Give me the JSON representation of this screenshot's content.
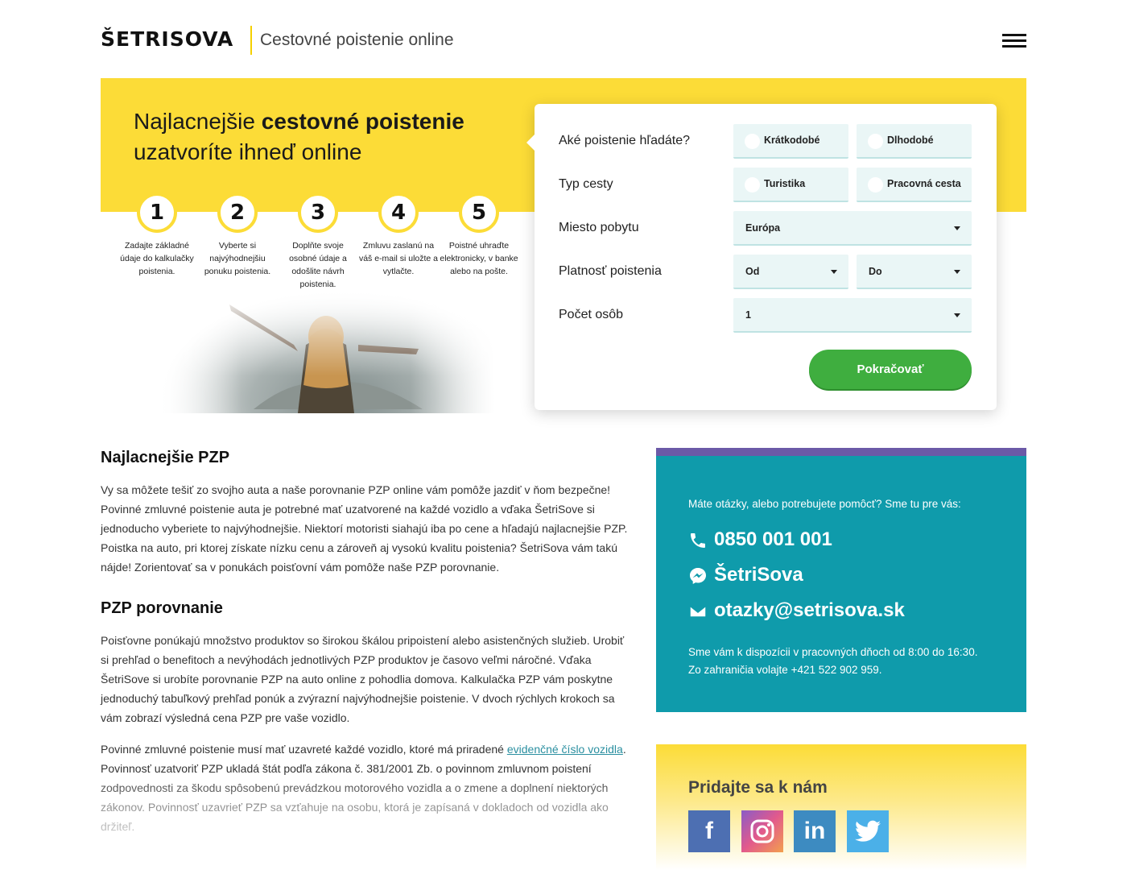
{
  "header": {
    "logo": "ŠETRISOVA",
    "tagline": "Cestovné poistenie online",
    "menu_icon": "hamburger-menu-icon"
  },
  "hero": {
    "title_prefix": "Najlacnejšie ",
    "title_bold": "cestovné poistenie",
    "title_suffix": "uzatvoríte ihneď online",
    "steps": [
      {
        "number": "1",
        "text": "Zadajte základné údaje do kalkulačky poistenia."
      },
      {
        "number": "2",
        "text": "Vyberte si najvýhodnejšiu ponuku poistenia."
      },
      {
        "number": "3",
        "text": "Doplňte svoje osobné údaje a odošlite návrh poistenia."
      },
      {
        "number": "4",
        "text": "Zmluvu zaslanú na váš e-mail si uložte a vytlačte."
      },
      {
        "number": "5",
        "text": "Poistné uhraďte elektronicky, v banke alebo na pošte."
      }
    ]
  },
  "form": {
    "type_label": "Aké poistenie hľadáte?",
    "type_options": [
      "Krátkodobé",
      "Dlhodobé"
    ],
    "trip_label": "Typ cesty",
    "trip_options": [
      "Turistika",
      "Pracovná cesta"
    ],
    "place_label": "Miesto pobytu",
    "place_value": "Európa",
    "validity_label": "Platnosť poistenia",
    "validity_from": "Od",
    "validity_to": "Do",
    "persons_label": "Počet osôb",
    "persons_value": "1",
    "submit_label": "Pokračovať"
  },
  "article": {
    "h1": "Najlacnejšie PZP",
    "p1": "Vy sa môžete tešiť zo svojho auta a naše porovnanie PZP online vám pomôže jazdiť v ňom bezpečne! Povinné zmluvné poistenie auta je potrebné mať uzatvorené na každé vozidlo a vďaka ŠetriSove si jednoducho vyberiete to najvýhodnejšie. Niektorí motoristi siahajú iba po cene a hľadajú najlacnejšie PZP. Poistka na auto, pri ktorej získate nízku cenu a zároveň aj vysokú kvalitu poistenia? ŠetriSova vám takú nájde! Zorientovať sa v ponukách poisťovní vám pomôže naše PZP porovnanie.",
    "h2": "PZP porovnanie",
    "p2": "Poisťovne ponúkajú množstvo produktov so širokou škálou pripoistení alebo asistenčných služieb. Urobiť si prehľad o benefitoch a nevýhodách jednotlivých PZP produktov je časovo veľmi náročné. Vďaka ŠetriSove si urobíte porovnanie PZP na auto online z pohodlia domova. Kalkulačka PZP vám poskytne jednoduchý tabuľkový prehľad ponúk a zvýrazní najvýhodnejšie poistenie. V dvoch rýchlych krokoch sa vám zobrazí výsledná cena PZP pre vaše vozidlo.",
    "p3_before": "Povinné zmluvné poistenie musí mať uzavreté každé vozidlo, ktoré má priradené ",
    "p3_link": "evidenčné číslo vozidla",
    "p3_after": ". Povinnosť uzatvoriť PZP ukladá štát podľa zákona č. 381/2001 Zb. o povinnom zmluvnom poistení zodpovednosti za škodu spôsobenú prevádzkou motorového vozidla a o zmene a doplnení niektorých zákonov. Povinnosť uzavrieť PZP sa vzťahuje na osobu, ktorá je zapísaná v dokladoch od vozidla ako držiteľ."
  },
  "help": {
    "intro": "Máte otázky, alebo potrebujete pomôcť? Sme tu pre vás:",
    "phone": "0850 001 001",
    "messenger": "ŠetriSova",
    "email": "otazky@setrisova.sk",
    "note_line1": "Sme vám k dispozícii v pracovných dňoch od 8:00 do 16:30.",
    "note_line2": "Zo zahraničia volajte +421 522 902 959."
  },
  "social": {
    "title": "Pridajte sa k nám",
    "icons": [
      "facebook-icon",
      "instagram-icon",
      "linkedin-icon",
      "twitter-icon"
    ]
  },
  "colors": {
    "yellow": "#fcdc37",
    "teal": "#0f9bab",
    "purple": "#6b5aa7",
    "green": "#3fae3f",
    "field_bg": "#eaf6f6"
  }
}
